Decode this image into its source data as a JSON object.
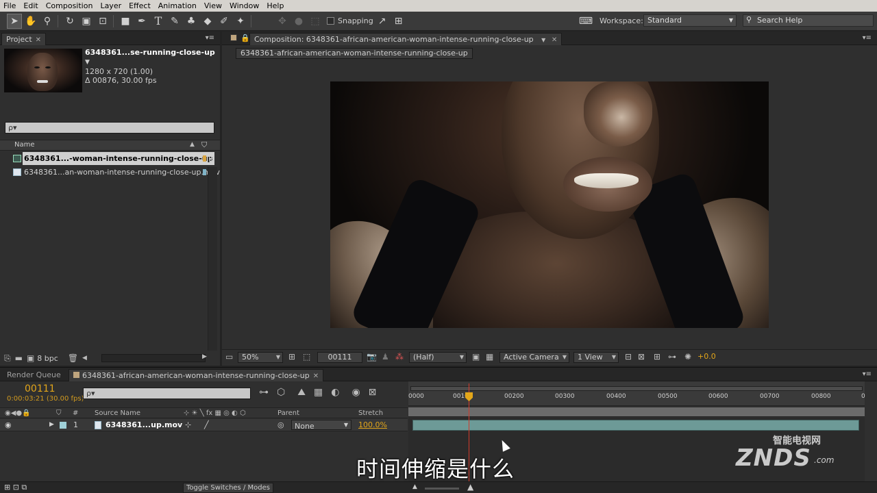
{
  "menu": [
    "File",
    "Edit",
    "Composition",
    "Layer",
    "Effect",
    "Animation",
    "View",
    "Window",
    "Help"
  ],
  "toolbar": {
    "snapping_label": "Snapping",
    "workspace_label": "Workspace:",
    "workspace_value": "Standard",
    "search_placeholder": "Search Help"
  },
  "project": {
    "tab_label": "Project",
    "item_title": "6348361...se-running-close-up",
    "item_size": "1280 x 720 (1.00)",
    "item_duration": "Δ 00876, 30.00 fps",
    "search_prefix": "ρ▾",
    "col_name": "Name",
    "rows": [
      {
        "label": "6348361...-woman-intense-running-close-up",
        "selected": true,
        "label_color": "#d9a441"
      },
      {
        "label": "6348361...an-woman-intense-running-close-up.mov",
        "selected": false,
        "label_color": "#7fb3c7"
      }
    ],
    "bpc": "8 bpc"
  },
  "composition": {
    "tab_label": "Composition: 6348361-african-american-woman-intense-running-close-up",
    "sub_tab": "6348361-african-american-woman-intense-running-close-up",
    "zoom": "50%",
    "timecode": "00111",
    "resolution": "(Half)",
    "camera": "Active Camera",
    "views": "1 View",
    "exposure": "+0.0"
  },
  "timeline": {
    "render_queue_tab": "Render Queue",
    "comp_tab": "6348361-african-american-woman-intense-running-close-up",
    "timecode": "00111",
    "timecode_sub": "0:00:03:21 (30.00 fps)",
    "search_prefix": "ρ▾",
    "col_num": "#",
    "col_source": "Source Name",
    "col_parent": "Parent",
    "col_stretch": "Stretch",
    "layer_num": "1",
    "layer_name": "6348361...up.mov",
    "parent_value": "None",
    "stretch_value": "100.0%",
    "ticks": [
      "0000",
      "00100",
      "00200",
      "00300",
      "00400",
      "00500",
      "00600",
      "00700",
      "00800",
      "0"
    ],
    "toggle_label": "Toggle Switches / Modes"
  },
  "overlay": {
    "subtitle": "时间伸缩是什么",
    "watermark_cn": "智能电视网",
    "watermark_brand": "ZNDS",
    "watermark_suffix": ".com"
  }
}
